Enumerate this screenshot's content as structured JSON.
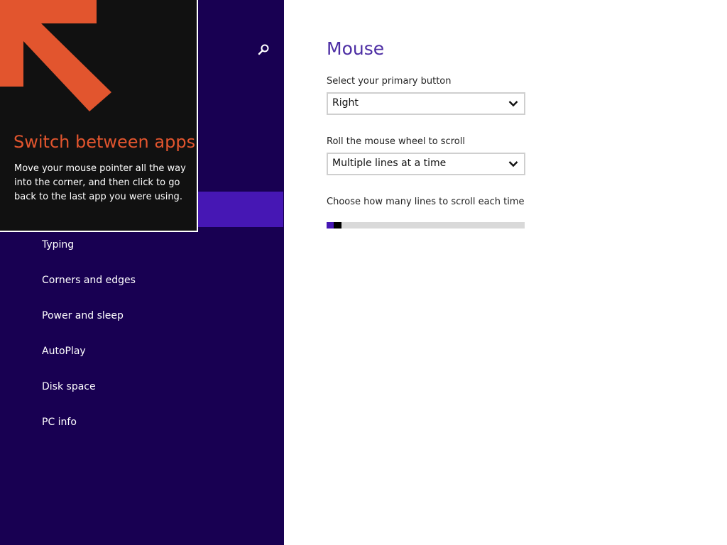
{
  "sidebar": {
    "search_icon": "search-icon",
    "items": [
      {
        "label": "Typing"
      },
      {
        "label": "Corners and edges"
      },
      {
        "label": "Power and sleep"
      },
      {
        "label": "AutoPlay"
      },
      {
        "label": "Disk space"
      },
      {
        "label": "PC info"
      }
    ]
  },
  "tip": {
    "title": "Switch between apps",
    "text": "Move your mouse pointer all the way into the corner, and then click to go back to the last app you were using.",
    "arrow_icon": "arrow-up-left-icon"
  },
  "main": {
    "title": "Mouse",
    "primary_button": {
      "label": "Select your primary button",
      "value": "Right"
    },
    "wheel": {
      "label": "Roll the mouse wheel to scroll",
      "value": "Multiple lines at a time"
    },
    "lines": {
      "label": "Choose how many lines to scroll each time",
      "level_fraction": 0.02
    }
  },
  "colors": {
    "sidebar_bg": "#180052",
    "selected_bg": "#4617b4",
    "title": "#4d2ea4",
    "tip_title": "#e2552e"
  }
}
